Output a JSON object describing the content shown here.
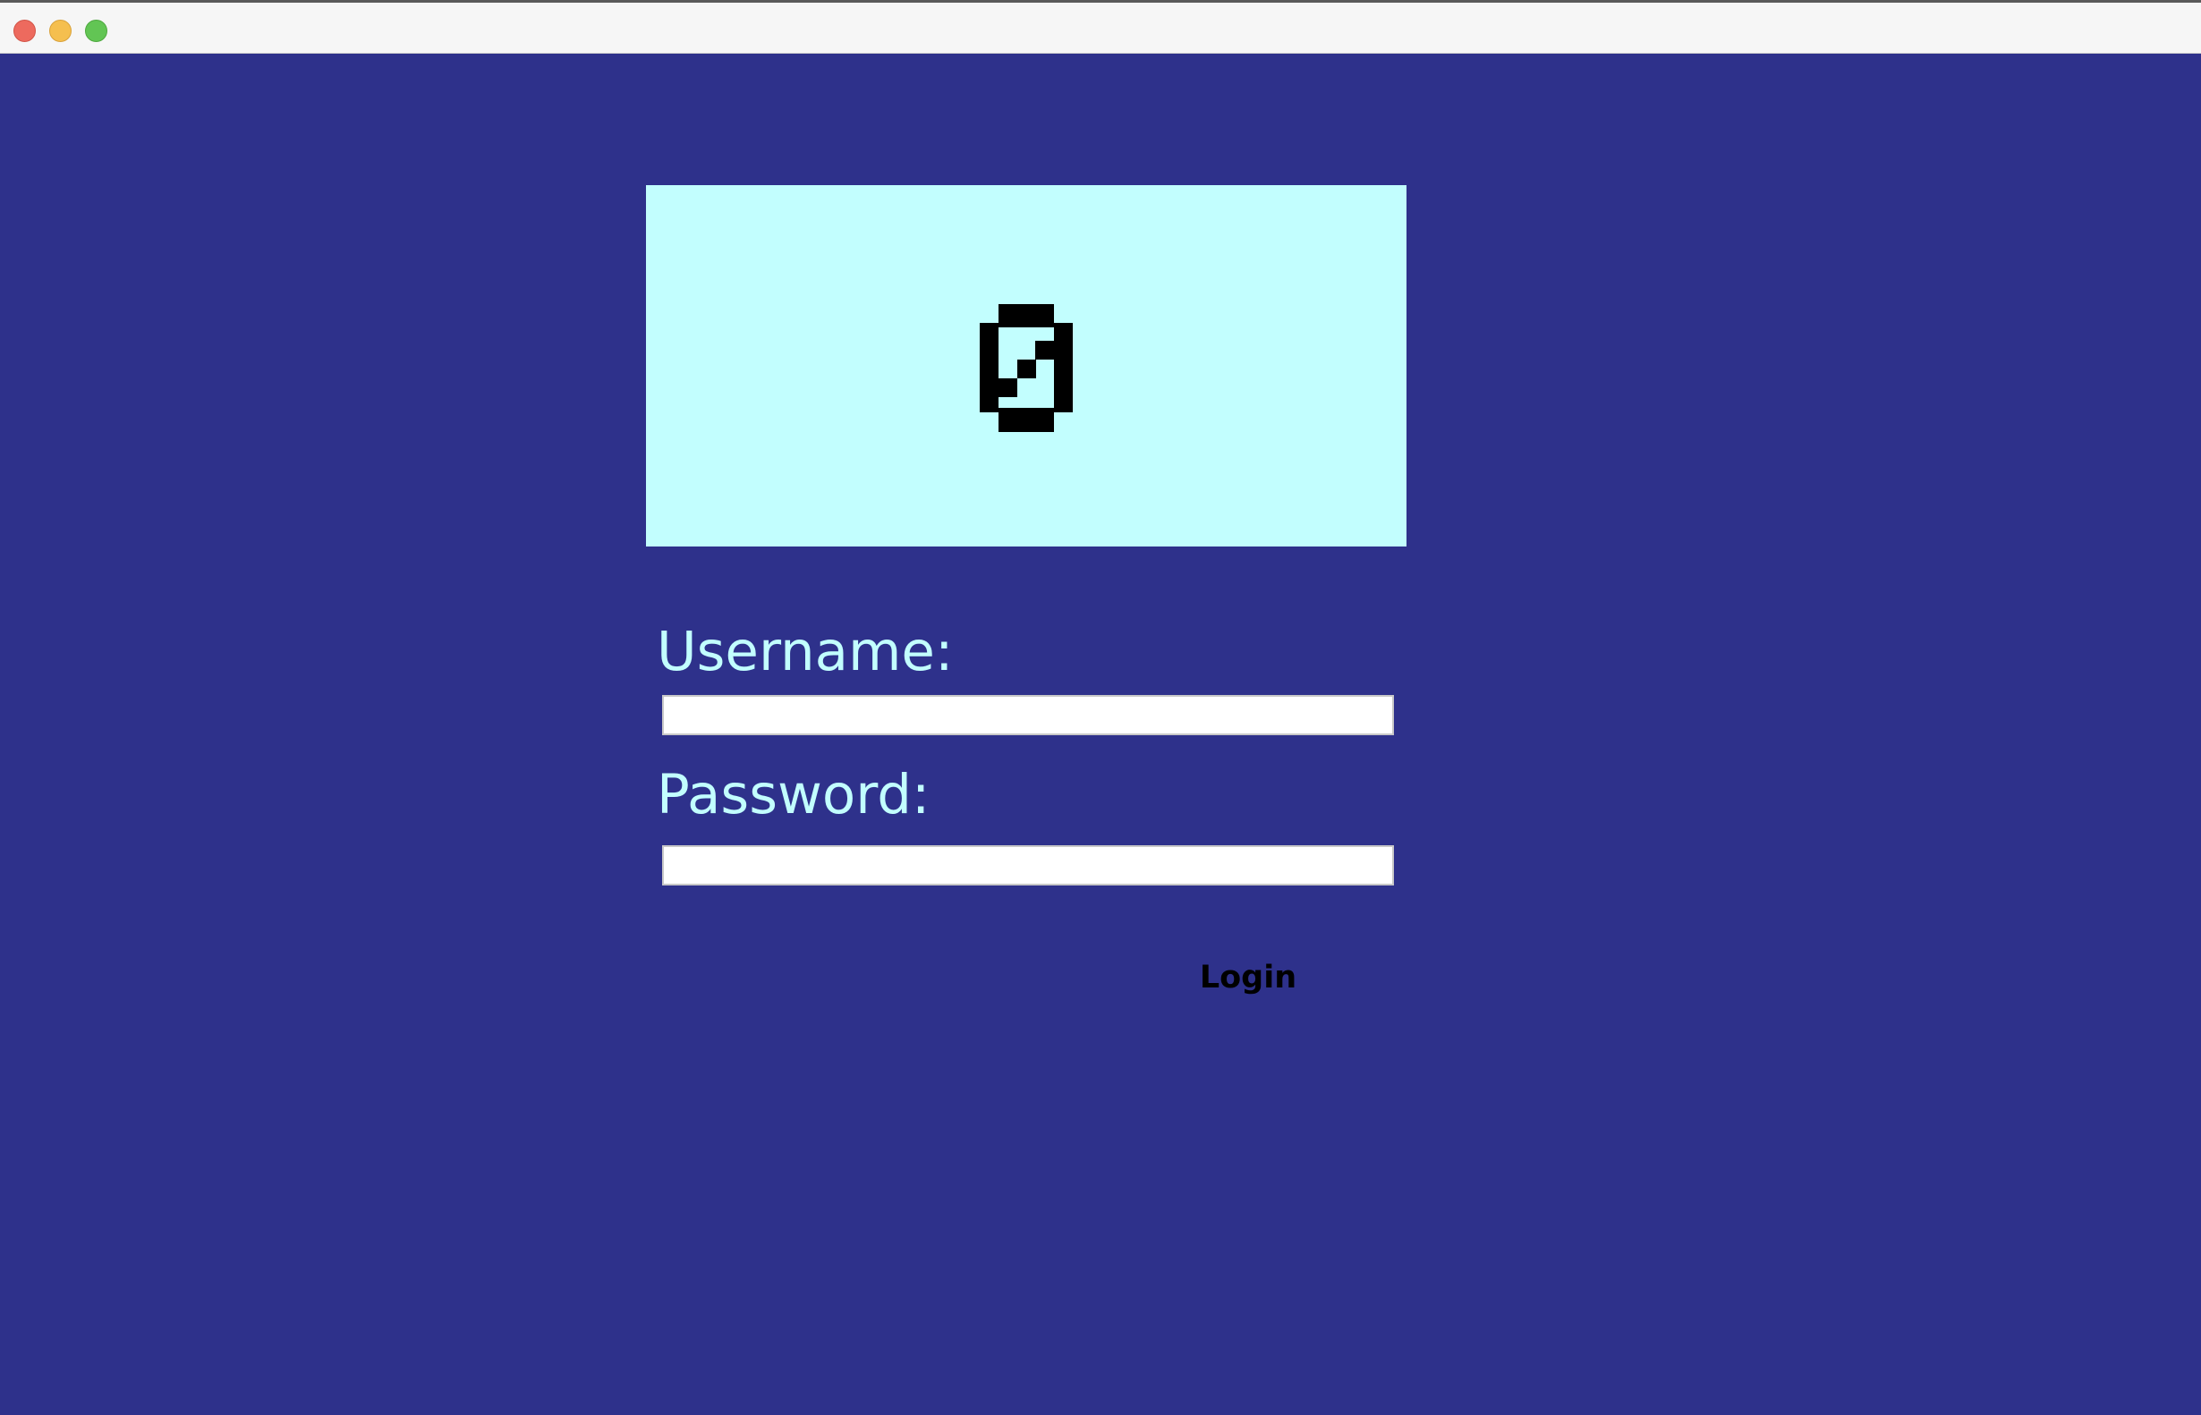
{
  "window": {
    "controls": [
      "close",
      "minimize",
      "zoom"
    ]
  },
  "logo": {
    "icon": "pixel-lock-icon",
    "background": "#c2fefe"
  },
  "form": {
    "username_label": "Username:",
    "username_value": "",
    "password_label": "Password:",
    "password_value": "",
    "login_label": "Login"
  },
  "colors": {
    "background": "#2e318b",
    "label": "#c2fefe",
    "panel": "#c2fefe",
    "input": "#ffffff",
    "button_text": "#000000"
  }
}
